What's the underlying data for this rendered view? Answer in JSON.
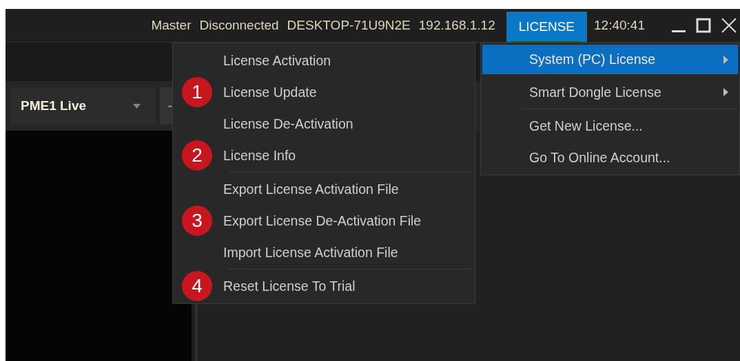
{
  "title_bar": {
    "items": [
      {
        "kind": "status",
        "text": "Master"
      },
      {
        "kind": "status",
        "text": "Disconnected"
      },
      {
        "kind": "status",
        "text": "DESKTOP-71U9N2E"
      },
      {
        "kind": "status",
        "text": "192.168.1.12"
      },
      {
        "kind": "menu",
        "text": "LICENSE",
        "selected": true
      },
      {
        "kind": "clock",
        "text": "12:40:41"
      }
    ]
  },
  "toolbar": {
    "output_select": "PME1 Live",
    "button": "-"
  },
  "license_menu": {
    "items": [
      {
        "kind": "item",
        "label": "System (PC) License",
        "submenu": true,
        "selected": true
      },
      {
        "kind": "item",
        "label": "Smart Dongle License",
        "submenu": true,
        "selected": false
      },
      {
        "kind": "separator"
      },
      {
        "kind": "item",
        "label": "Get New License...",
        "submenu": false,
        "selected": false
      },
      {
        "kind": "item",
        "label": "Go To Online Account...",
        "submenu": false,
        "selected": false
      }
    ]
  },
  "system_license_menu": {
    "items": [
      {
        "kind": "item",
        "label": "License Activation"
      },
      {
        "kind": "item",
        "label": "License Update",
        "badge": "1"
      },
      {
        "kind": "item",
        "label": "License De-Activation"
      },
      {
        "kind": "item",
        "label": "License Info",
        "badge": "2"
      },
      {
        "kind": "separator"
      },
      {
        "kind": "item",
        "label": "Export License Activation File"
      },
      {
        "kind": "item",
        "label": "Export License De-Activation File",
        "badge": "3"
      },
      {
        "kind": "item",
        "label": "Import License Activation File"
      },
      {
        "kind": "separator"
      },
      {
        "kind": "item",
        "label": "Reset License To Trial",
        "badge": "4"
      }
    ]
  }
}
